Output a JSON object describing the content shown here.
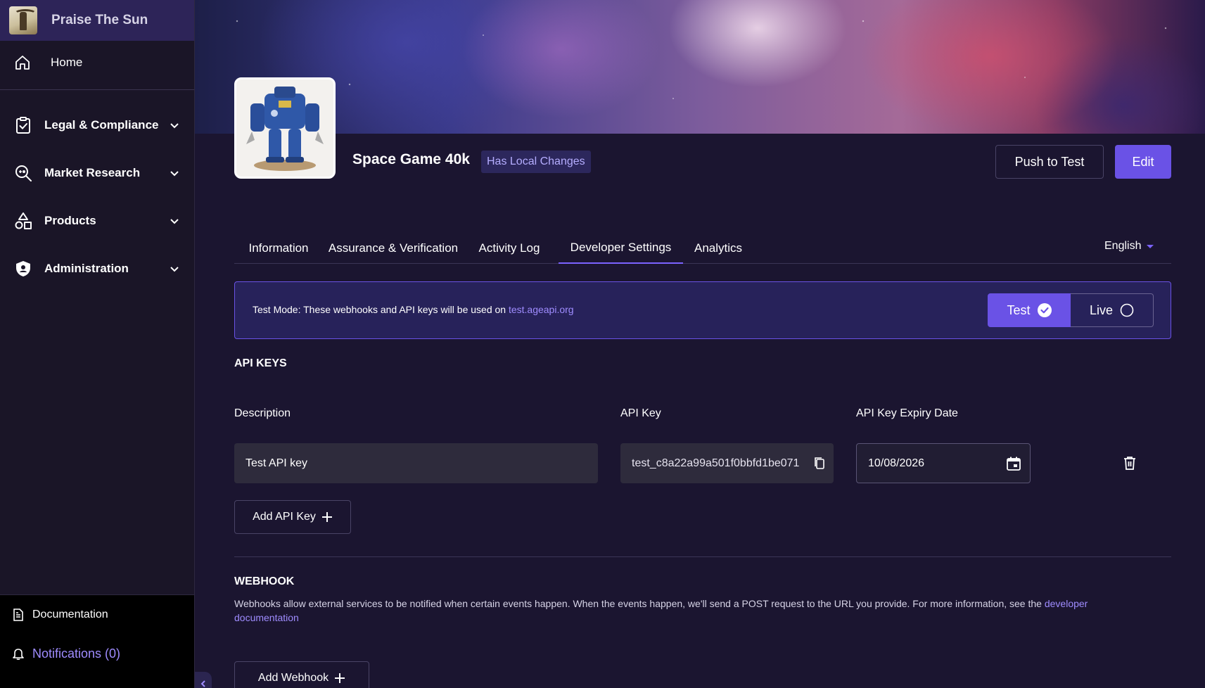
{
  "sidebar": {
    "brand": {
      "name": "Praise The Sun"
    },
    "home": {
      "label": "Home"
    },
    "groups": [
      {
        "label": "Legal & Compliance",
        "icon": "clipboard-check-icon"
      },
      {
        "label": "Market Research",
        "icon": "gamepad-search-icon"
      },
      {
        "label": "Products",
        "icon": "shapes-icon"
      },
      {
        "label": "Administration",
        "icon": "shield-icon"
      }
    ],
    "documentation": {
      "label": "Documentation"
    },
    "notifications": {
      "label": "Notifications (0)"
    }
  },
  "header": {
    "title": "Space Game 40k",
    "badge": "Has Local Changes",
    "push_label": "Push to Test",
    "edit_label": "Edit"
  },
  "tabs": [
    {
      "label": "Information",
      "active": false
    },
    {
      "label": "Assurance & Verification",
      "active": false
    },
    {
      "label": "Activity Log",
      "active": false
    },
    {
      "label": "Developer Settings",
      "active": true
    },
    {
      "label": "Analytics",
      "active": false
    }
  ],
  "language": {
    "selected": "English"
  },
  "mode": {
    "message": "Test Mode: These webhooks and API keys will be used on ",
    "link": "test.ageapi.org",
    "test_label": "Test",
    "live_label": "Live",
    "selected": "Test"
  },
  "api_keys": {
    "section_title": "API KEYS",
    "columns": {
      "description": "Description",
      "key": "API Key",
      "expiry": "API Key Expiry Date"
    },
    "rows": [
      {
        "description": "Test API key",
        "key": "test_c8a22a99a501f0bbfd1be071",
        "expiry": "10/08/2026"
      }
    ],
    "add_label": "Add API Key"
  },
  "webhook": {
    "section_title": "WEBHOOK",
    "description": "Webhooks allow external services to be notified when certain events happen. When the events happen, we'll send a POST request to the URL you provide. For more information, see the ",
    "link": "developer documentation",
    "add_label": "Add Webhook"
  },
  "colors": {
    "accent": "#6a52e6",
    "link": "#9f8cff",
    "sidebar_bg": "#1a1527",
    "main_bg": "#1b1530"
  }
}
